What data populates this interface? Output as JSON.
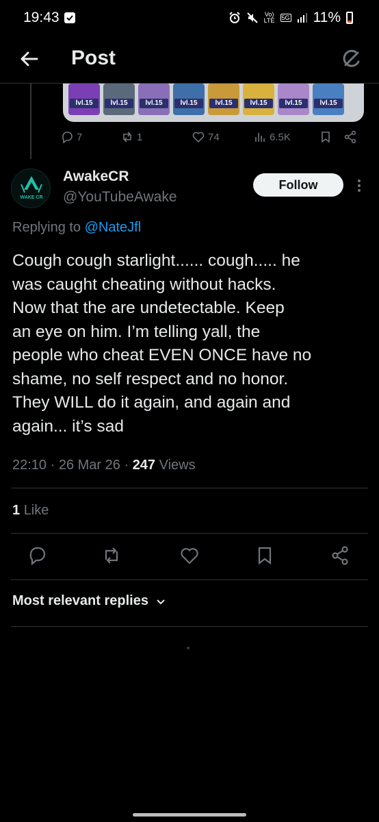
{
  "status_bar": {
    "time": "19:43",
    "volte_top": "Vo)",
    "volte_bottom": "LTE",
    "network": "5G",
    "battery": "11%"
  },
  "header": {
    "title": "Post"
  },
  "previous_tweet": {
    "card_level_label": "lvl.15",
    "replies": "7",
    "reposts": "1",
    "likes": "74",
    "views": "6.5K"
  },
  "tweet": {
    "author_name": "AwakeCR",
    "author_handle": "@YouTubeAwake",
    "avatar_text": "WAKE CR",
    "follow_label": "Follow",
    "replying_prefix": "Replying to ",
    "replying_to": "@NateJfl",
    "text": "Cough cough starlight...... cough..... he\nwas caught cheating without hacks.\nNow that the are undetectable. Keep\nan eye on him. I’m telling yall, the\npeople who cheat EVEN ONCE have no\nshame, no self respect and no honor.\nThey WILL do it again, and again and\nagain... it’s sad",
    "time": "22:10",
    "date": "26 Mar 26",
    "views_count": "247",
    "views_label": "Views",
    "like_count": "1",
    "like_label": "Like"
  },
  "replies_sort": {
    "label": "Most relevant replies"
  },
  "colors": {
    "accent": "#1d9bf0",
    "muted": "#71767b",
    "text": "#e7e9ea",
    "divider": "#2f3336"
  },
  "icons": [
    "back-arrow-icon",
    "grok-icon",
    "reply-icon",
    "repost-icon",
    "like-icon",
    "views-icon",
    "bookmark-icon",
    "share-icon",
    "more-icon",
    "chevron-down-icon"
  ]
}
